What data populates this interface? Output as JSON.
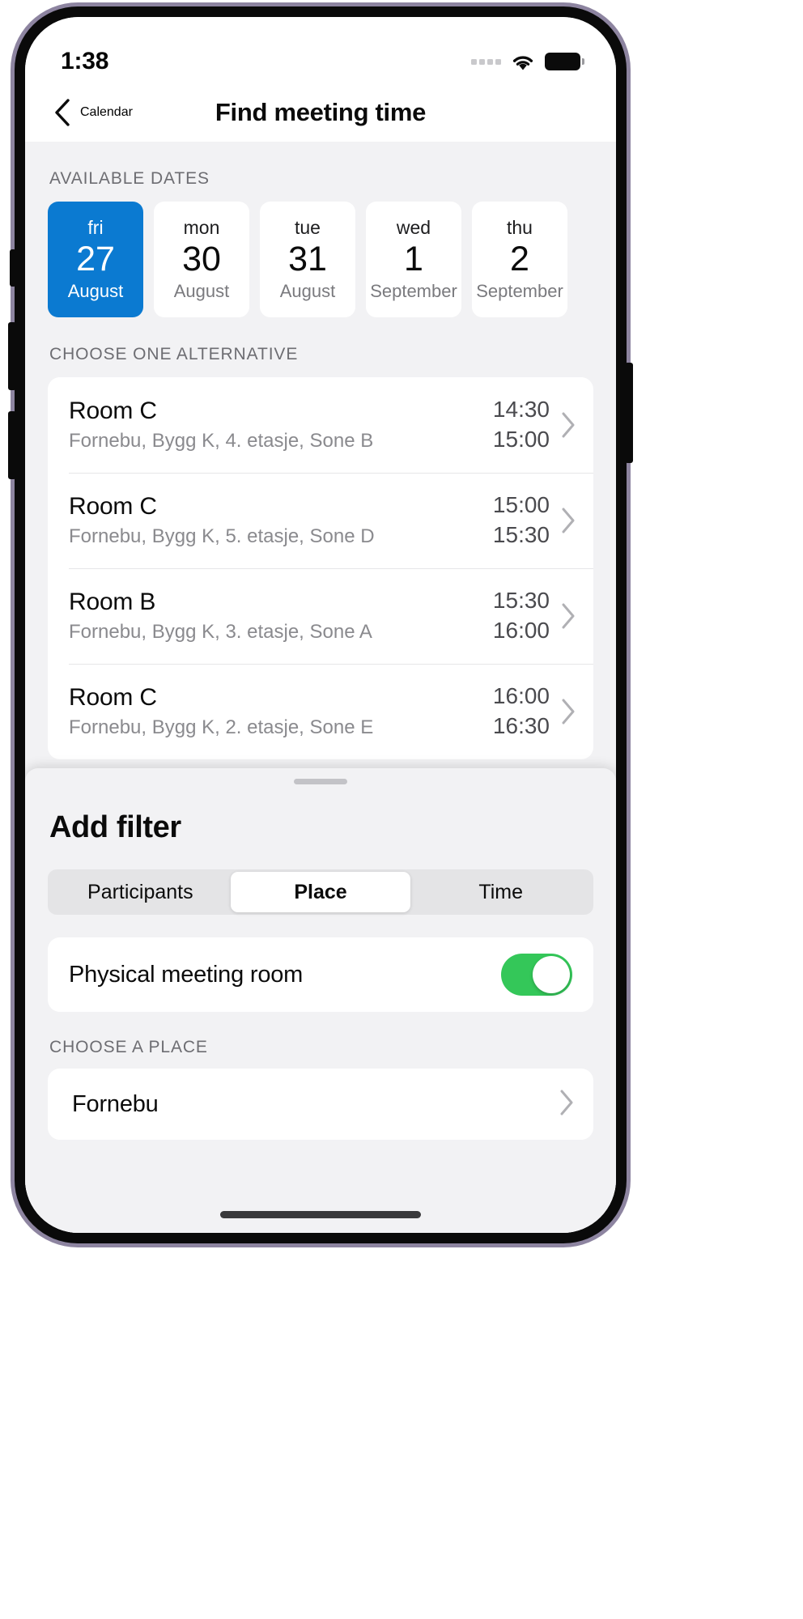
{
  "status_bar": {
    "time": "1:38",
    "signal_icon": "signal-dots-icon",
    "wifi_icon": "wifi-icon",
    "battery_icon": "battery-full-icon"
  },
  "nav_bar": {
    "back_label": "Calendar",
    "back_icon": "chevron-left-icon",
    "title": "Find meeting time"
  },
  "available_dates": {
    "label": "AVAILABLE DATES",
    "accent_color": "#0b7ad1",
    "cards": [
      {
        "dow": "fri",
        "day": "27",
        "month": "August",
        "selected": true
      },
      {
        "dow": "mon",
        "day": "30",
        "month": "August",
        "selected": false
      },
      {
        "dow": "tue",
        "day": "31",
        "month": "August",
        "selected": false
      },
      {
        "dow": "wed",
        "day": "1",
        "month": "September",
        "selected": false
      },
      {
        "dow": "thu",
        "day": "2",
        "month": "September",
        "selected": false
      }
    ]
  },
  "alternatives": {
    "label": "CHOOSE ONE ALTERNATIVE",
    "rows": [
      {
        "title": "Room C",
        "subtitle": "Fornebu, Bygg K, 4. etasje, Sone B",
        "start": "14:30",
        "end": "15:00"
      },
      {
        "title": "Room C",
        "subtitle": "Fornebu, Bygg K, 5. etasje, Sone D",
        "start": "15:00",
        "end": "15:30"
      },
      {
        "title": "Room B",
        "subtitle": "Fornebu, Bygg K, 3. etasje, Sone A",
        "start": "15:30",
        "end": "16:00"
      },
      {
        "title": "Room C",
        "subtitle": "Fornebu, Bygg K, 2. etasje, Sone E",
        "start": "16:00",
        "end": "16:30"
      }
    ]
  },
  "bottom_sheet": {
    "title": "Add filter",
    "segments": [
      {
        "label": "Participants",
        "active": false
      },
      {
        "label": "Place",
        "active": true
      },
      {
        "label": "Time",
        "active": false
      }
    ],
    "toggle": {
      "label": "Physical meeting room",
      "on": true,
      "on_color": "#34c759"
    },
    "place_section_label": "CHOOSE A PLACE",
    "place_value": "Fornebu"
  }
}
